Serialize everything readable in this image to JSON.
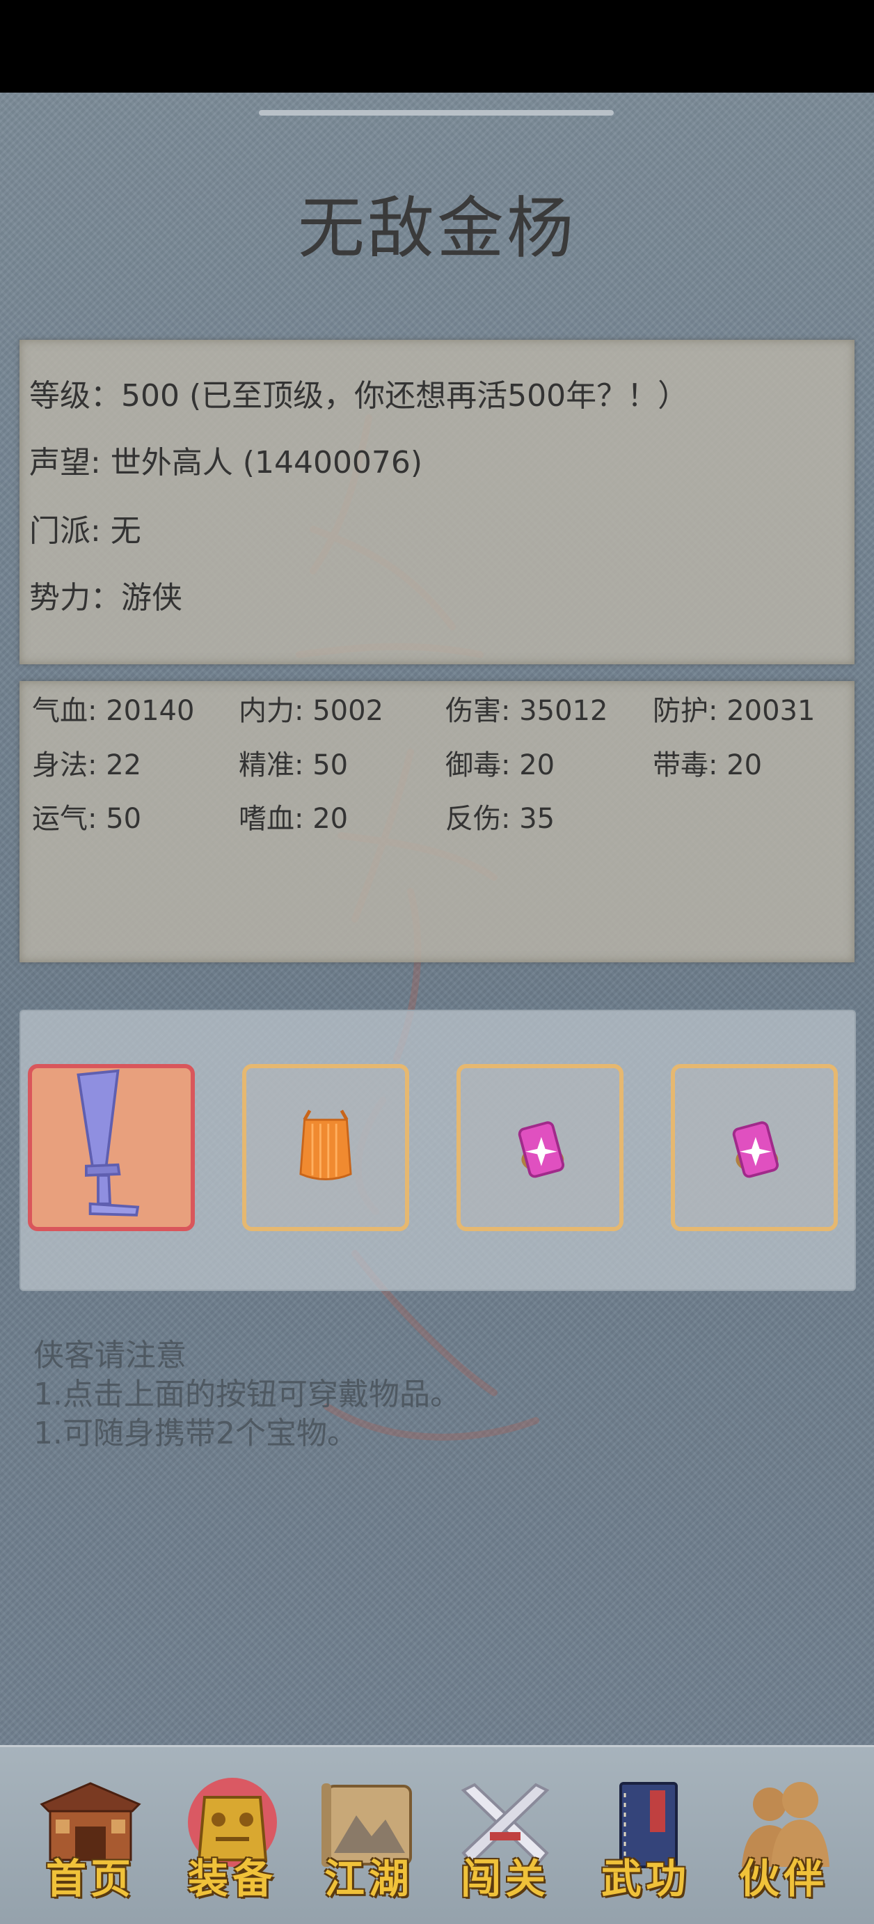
{
  "title": "无敌金杨",
  "info": {
    "level": "等级：500 (已至顶级，你还想再活500年？！）",
    "prestige": "声望: 世外高人 (14400076)",
    "sect": "门派: 无",
    "faction": "势力：游侠"
  },
  "stats": {
    "hp": "气血: 20140",
    "internal": "内力: 5002",
    "damage": "伤害: 35012",
    "defense": "防护: 20031",
    "agility": "身法: 22",
    "accuracy": "精准: 50",
    "poison_resist": "御毒: 20",
    "poison": "带毒: 20",
    "luck": "运气: 50",
    "bloodthirst": "嗜血: 20",
    "reflect": "反伤: 35"
  },
  "equipment": {
    "slots": [
      {
        "item_icon": "sword-icon",
        "selected": true
      },
      {
        "item_icon": "armor-icon",
        "selected": false
      },
      {
        "item_icon": "treasure-icon",
        "selected": false
      },
      {
        "item_icon": "treasure-icon",
        "selected": false
      }
    ]
  },
  "notice": {
    "heading": "侠客请注意",
    "line1": "1.点击上面的按钮可穿戴物品。",
    "line2": "1.可随身携带2个宝物。"
  },
  "nav": {
    "items": [
      {
        "label": "首页",
        "icon": "house-icon"
      },
      {
        "label": "装备",
        "icon": "armor-icon"
      },
      {
        "label": "江湖",
        "icon": "scroll-map-icon"
      },
      {
        "label": "闯关",
        "icon": "crossed-swords-icon"
      },
      {
        "label": "武功",
        "icon": "book-icon"
      },
      {
        "label": "伙伴",
        "icon": "companions-icon"
      }
    ]
  },
  "colors": {
    "background": "#6f7f8d",
    "paper": "#b9b4a8",
    "slot_border": "#e6b870",
    "slot_selected_border": "#d9565b",
    "nav_label": "#f0c23a"
  }
}
